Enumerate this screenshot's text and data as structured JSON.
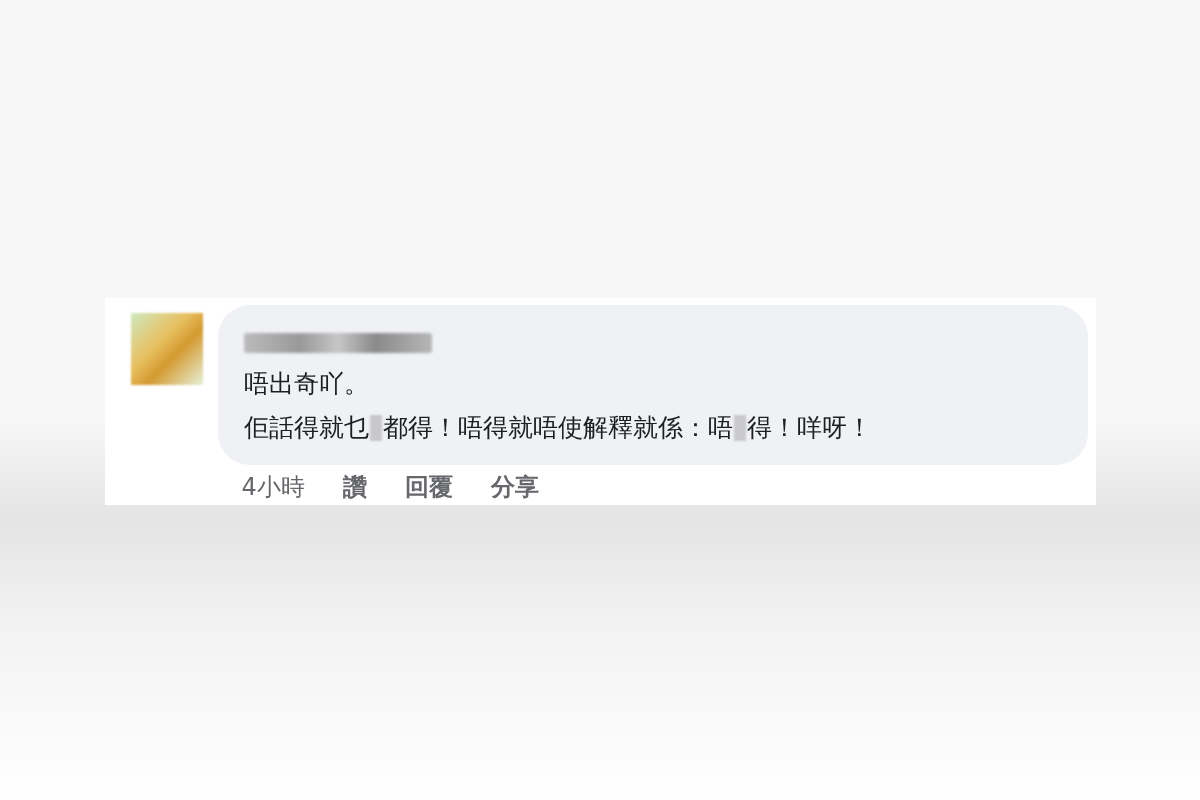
{
  "comment": {
    "lines": [
      {
        "parts": [
          {
            "kind": "text",
            "text": "唔出奇吖。"
          }
        ]
      },
      {
        "parts": [
          {
            "kind": "text",
            "text": "佢話得就乜"
          },
          {
            "kind": "censor"
          },
          {
            "kind": "text",
            "text": "都得！唔得就唔使解釋就係：唔"
          },
          {
            "kind": "censor"
          },
          {
            "kind": "text",
            "text": "得！咩呀！"
          }
        ]
      }
    ],
    "time": "4小時",
    "actions": [
      "讚",
      "回覆",
      "分享"
    ]
  }
}
